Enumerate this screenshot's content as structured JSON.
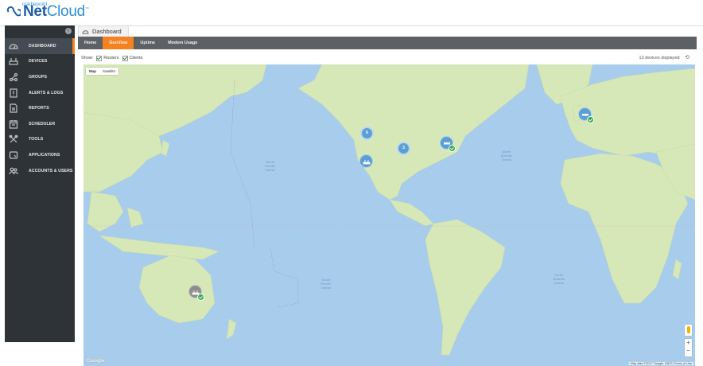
{
  "brand": {
    "small": "cradlepoint",
    "name_bold": "Net",
    "name_light": "Cloud",
    "tm": "™"
  },
  "sidebar": {
    "items": [
      {
        "label": "DASHBOARD",
        "icon": "dashboard-icon",
        "active": true
      },
      {
        "label": "DEVICES",
        "icon": "devices-icon"
      },
      {
        "label": "GROUPS",
        "icon": "groups-icon"
      },
      {
        "label": "ALERTS & LOGS",
        "icon": "alerts-logs-icon"
      },
      {
        "label": "REPORTS",
        "icon": "reports-icon"
      },
      {
        "label": "SCHEDULER",
        "icon": "scheduler-icon"
      },
      {
        "label": "TOOLS",
        "icon": "tools-icon"
      },
      {
        "label": "APPLICATIONS",
        "icon": "applications-icon"
      },
      {
        "label": "ACCOUNTS & USERS",
        "icon": "accounts-users-icon"
      }
    ]
  },
  "header": {
    "tab_label": "Dashboard"
  },
  "subnav": {
    "tabs": [
      "Home",
      "GeoView",
      "Uptime",
      "Modem Usage"
    ],
    "active": "GeoView"
  },
  "filters": {
    "show_label": "Show:",
    "routers_label": "Routers",
    "clients_label": "Clients",
    "count_text": "13 devices displayed"
  },
  "map": {
    "type_map": "Map",
    "type_satellite": "Satellite",
    "google": "Google",
    "attribution": "Map data ©2017 Google, INEGI  Terms of Use",
    "clusters": [
      "6",
      "3"
    ],
    "oceans": {
      "north_pacific": "North\nPacific\nOcean",
      "south_pacific": "South\nPacific\nOcean",
      "north_atlantic": "North\nAtlantic\nOcean",
      "south_atlantic": "South\nAtlantic\nOcean"
    },
    "colors": {
      "water": "#a8cdec",
      "land": "#d7e8b8",
      "cluster": "#5a9fd6",
      "status_ok": "#2fa84f",
      "accent": "#f58220"
    }
  }
}
